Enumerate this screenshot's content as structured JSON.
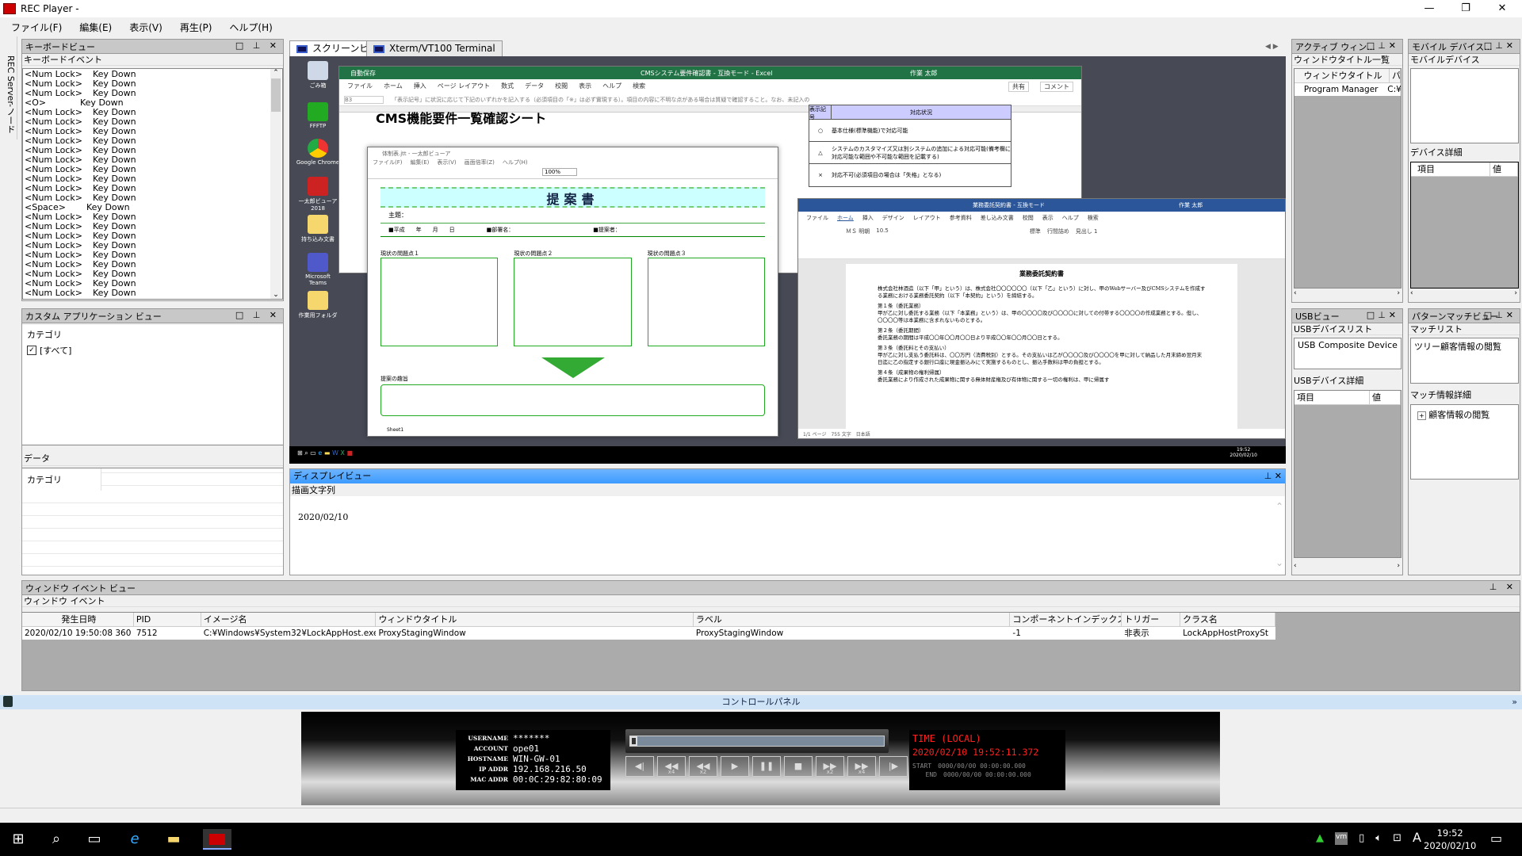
{
  "window": {
    "title": "REC Player -",
    "app_icon": "REC"
  },
  "menu": [
    "ファイル(F)",
    "編集(E)",
    "表示(V)",
    "再生(P)",
    "ヘルプ(H)"
  ],
  "side_strip": "REC Server-ノード",
  "keyboard_view": {
    "title": "キーボードビュー",
    "subtitle": "キーボードイベント",
    "events": [
      {
        "key": "<Num Lock>",
        "action": "Key Down"
      },
      {
        "key": "<Num Lock>",
        "action": "Key Down"
      },
      {
        "key": "<Num Lock>",
        "action": "Key Down"
      },
      {
        "key": "<O>",
        "action": "Key Down"
      },
      {
        "key": "<Num Lock>",
        "action": "Key Down"
      },
      {
        "key": "<Num Lock>",
        "action": "Key Down"
      },
      {
        "key": "<Num Lock>",
        "action": "Key Down"
      },
      {
        "key": "<Num Lock>",
        "action": "Key Down"
      },
      {
        "key": "<Num Lock>",
        "action": "Key Down"
      },
      {
        "key": "<Num Lock>",
        "action": "Key Down"
      },
      {
        "key": "<Num Lock>",
        "action": "Key Down"
      },
      {
        "key": "<Num Lock>",
        "action": "Key Down"
      },
      {
        "key": "<Num Lock>",
        "action": "Key Down"
      },
      {
        "key": "<Num Lock>",
        "action": "Key Down"
      },
      {
        "key": "<Space>",
        "action": "Key Down"
      },
      {
        "key": "<Num Lock>",
        "action": "Key Down"
      },
      {
        "key": "<Num Lock>",
        "action": "Key Down"
      },
      {
        "key": "<Num Lock>",
        "action": "Key Down"
      },
      {
        "key": "<Num Lock>",
        "action": "Key Down"
      },
      {
        "key": "<Num Lock>",
        "action": "Key Down"
      },
      {
        "key": "<Num Lock>",
        "action": "Key Down"
      },
      {
        "key": "<Num Lock>",
        "action": "Key Down"
      },
      {
        "key": "<Num Lock>",
        "action": "Key Down"
      },
      {
        "key": "<Num Lock>",
        "action": "Key Down"
      }
    ]
  },
  "custom_app_view": {
    "title": "カスタム アプリケーション ビュー",
    "category_header": "カテゴリ",
    "all_label": "[すべて]",
    "all_checked": true,
    "data_label": "データ",
    "data_category_header": "カテゴリ"
  },
  "tabs": [
    {
      "label": "スクリーンビュー",
      "active": true
    },
    {
      "label": "Xterm/VT100 Terminal",
      "active": false
    }
  ],
  "screen": {
    "desktop_icons": [
      "ごみ箱",
      "FFFTP",
      "Google Chrome",
      "一太郎ビューア2018",
      "持ち込み文書",
      "Microsoft Teams",
      "作業用フォルダ"
    ],
    "excel": {
      "titlebar": "CMSシステム要件確認書 - 互換モード - Excel",
      "autosave": "自動保存",
      "user": "作業 太郎",
      "share": "共有",
      "comment": "コメント",
      "ribbon": [
        "ファイル",
        "ホーム",
        "挿入",
        "ページ レイアウト",
        "数式",
        "データ",
        "校閲",
        "表示",
        "ヘルプ",
        "検索"
      ],
      "cell_ref": "B3",
      "formula": "「表示記号」に状況に応じて下記のいずれかを記入する（必須項目の「※」は必ず實現する）。項目の内容に不明な点がある場合は質疑で確認すること。なお、未記入の",
      "sheet_title": "CMS機能要件一覧確認シート",
      "legend_header": [
        "表示記号",
        "対応状況"
      ],
      "legend": [
        {
          "mark": "○",
          "text": "基本仕様(標準機能)で対応可能"
        },
        {
          "mark": "△",
          "text": "システムのカスタマイズ又は別システムの追加による対応可能(備考欄に対応可能な範囲や不可能な範囲を記載する)"
        },
        {
          "mark": "×",
          "text": "対応不可(必須項目の場合は「失格」となる)"
        }
      ]
    },
    "ichitaro": {
      "titlebar": "体制表.jtt - 一太郎ビューア",
      "menu": [
        "ファイル(F)",
        "編集(E)",
        "表示(V)",
        "画面倍率(Z)",
        "ヘルプ(H)"
      ],
      "zoom": "100%",
      "heading": "提案書",
      "subject": "主題：",
      "date_line": "■平成　　年　　月　　日",
      "dept": "■部署名：",
      "proposer": "■提案者：",
      "problems": [
        "現状の問題点１",
        "現状の問題点２",
        "現状の問題点３"
      ],
      "purpose": "提案の趣旨",
      "sheet": "Sheet1"
    },
    "word": {
      "titlebar": "業務委託契約書 - 互換モード",
      "user": "作業 太郎",
      "ribbon": [
        "ファイル",
        "ホーム",
        "挿入",
        "デザイン",
        "レイアウト",
        "参考資料",
        "差し込み文書",
        "校閲",
        "表示",
        "ヘルプ",
        "検索"
      ],
      "font": "ＭＳ 明朝",
      "size": "10.5",
      "styles": [
        "標準",
        "行間詰め",
        "見出し 1"
      ],
      "doc_title": "業務委託契約書",
      "paragraphs": [
        "株式会社林酒造（以下「甲」という）は、株式会社〇〇〇〇〇〇（以下「乙」という）に対し、甲のWebサーバー及びCMSシステムを作成する業務における業務委託契約（以下「本契約」という）を締結する。",
        "第１条（委託業務）",
        "甲が乙に対し委託する業務（以下「本業務」という）は、甲の〇〇〇〇及び〇〇〇〇に対しての付帯する〇〇〇〇の作成業務とする。但し、〇〇〇〇等は本業務に含まれないものとする。",
        "第２条（委託期間）",
        "委託業務の期間は平成〇〇年〇〇月〇〇日より平成〇〇年〇〇月〇〇日とする。",
        "第３条（委託料とその支払い）",
        "甲が乙に対し支払う委託料は、〇〇万円（消費税別）とする。その支払いは乙が〇〇〇〇及び〇〇〇〇を甲に対して納品した月末締め翌月末日迄に乙の指定する銀行口座に現金振込みにて実施するものとし、振込手数料は甲の負担とする。",
        "第４条（成果物の権利帰属）",
        "委託業務により作成された成果物に関する無体財産権及び有体物に関する一切の権利は、甲に帰属す"
      ],
      "status": "1/1 ページ　755 文字　日本語"
    },
    "clock_time": "19:52",
    "clock_date": "2020/02/10"
  },
  "display_view": {
    "title": "ディスプレイビュー",
    "subtitle": "描画文字列",
    "text": "2020/02/10"
  },
  "active_window": {
    "title": "アクティブ ウィン...",
    "subtitle": "ウィンドウタイトル一覧",
    "columns": [
      "ウィンドウタイトル",
      "パ"
    ],
    "rows": [
      [
        "Program Manager",
        "C:¥"
      ]
    ]
  },
  "mobile": {
    "title": "モバイル デバイス...",
    "subtitle": "モバイルデバイス",
    "detail": "デバイス詳細",
    "columns": [
      "項目",
      "値"
    ]
  },
  "usb": {
    "title": "USBビュー",
    "list_label": "USBデバイスリスト",
    "devices": [
      "USB Composite Device"
    ],
    "detail": "USBデバイス詳細",
    "columns": [
      "項目",
      "値"
    ]
  },
  "pattern": {
    "title": "パターンマッチビュー",
    "list_label": "マッチリスト",
    "matches": [
      "ツリー顧客情報の閲覧"
    ],
    "detail": "マッチ情報詳細",
    "tree": [
      "顧客情報の閲覧"
    ]
  },
  "window_events": {
    "title": "ウィンドウ イベント ビュー",
    "subtitle": "ウィンドウ イベント",
    "columns": [
      "発生日時",
      "PID",
      "イメージ名",
      "ウィンドウタイトル",
      "ラベル",
      "コンポーネントインデックス",
      "トリガー",
      "クラス名"
    ],
    "rows": [
      [
        "2020/02/10 19:50:08 360",
        "7512",
        "C:¥Windows¥System32¥LockAppHost.exe",
        "ProxyStagingWindow",
        "ProxyStagingWindow",
        "-1",
        "非表示",
        "LockAppHostProxySt"
      ]
    ]
  },
  "control_panel": {
    "title": "コントロールパネル",
    "info": [
      {
        "label": "USERNAME",
        "value": "*******"
      },
      {
        "label": "ACCOUNT",
        "value": "ope01"
      },
      {
        "label": "HOSTNAME",
        "value": "WIN-GW-01"
      },
      {
        "label": "IP ADDR",
        "value": "192.168.216.50"
      },
      {
        "label": "MAC ADDR",
        "value": "00:0C:29:82:80:09"
      }
    ],
    "progress": 0,
    "buttons": [
      {
        "icon": "step-back-icon",
        "glyph": "◀|",
        "sub": ""
      },
      {
        "icon": "rewind-x4-icon",
        "glyph": "◀◀",
        "sub": "x4"
      },
      {
        "icon": "rewind-x2-icon",
        "glyph": "◀◀",
        "sub": "x2"
      },
      {
        "icon": "play-icon",
        "glyph": "▶",
        "sub": ""
      },
      {
        "icon": "pause-icon",
        "glyph": "❚❚",
        "sub": ""
      },
      {
        "icon": "stop-icon",
        "glyph": "■",
        "sub": ""
      },
      {
        "icon": "forward-x2-icon",
        "glyph": "▶▶",
        "sub": "x2"
      },
      {
        "icon": "forward-x4-icon",
        "glyph": "▶▶",
        "sub": "x4"
      },
      {
        "icon": "step-forward-icon",
        "glyph": "|▶",
        "sub": ""
      }
    ],
    "time_label": "TIME (LOCAL)",
    "time": "2020/02/10 19:52:11.372",
    "start_label": "START",
    "start": "0000/00/00 00:00:00.000",
    "end_label": "END",
    "end": "0000/00/00 00:00:00.000"
  },
  "taskbar": {
    "time": "19:52",
    "date": "2020/02/10",
    "ime": "A"
  },
  "colors": {
    "display_header": "#3d9bff",
    "control_header": "#cfe3f7",
    "time_red": "#ff2020"
  }
}
